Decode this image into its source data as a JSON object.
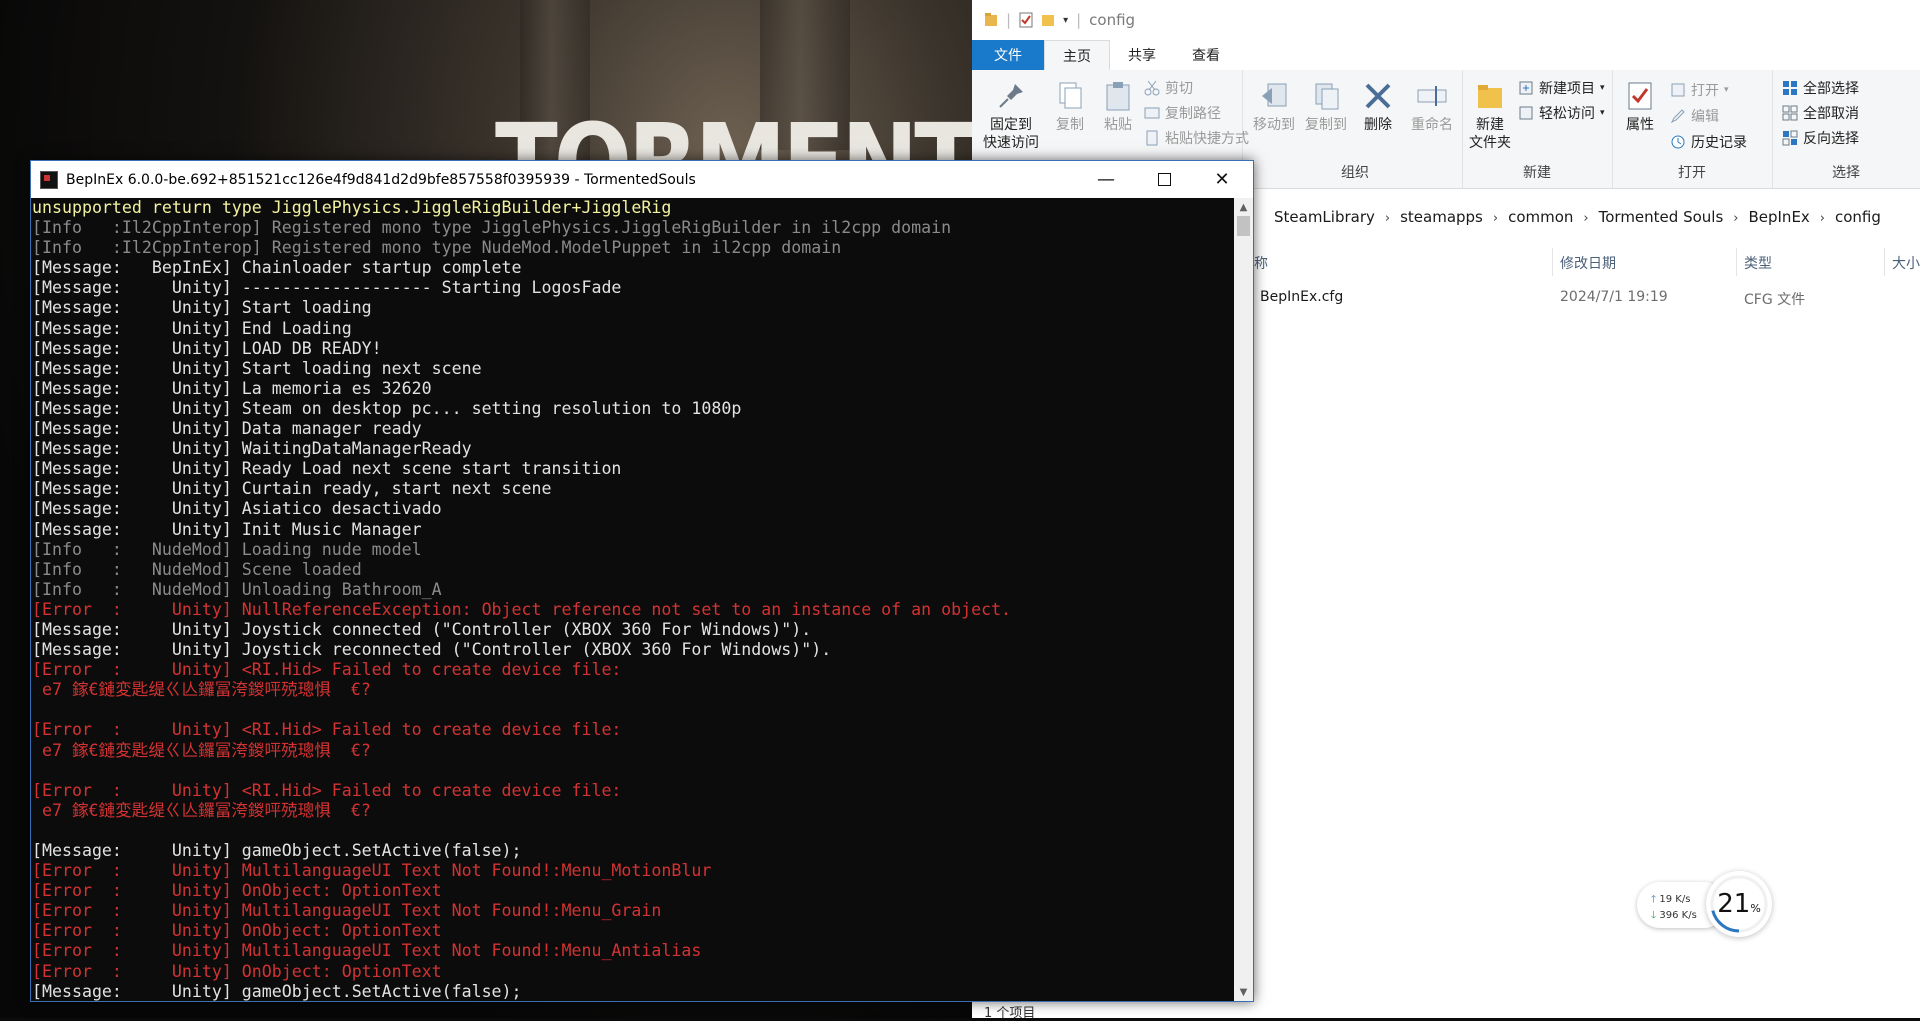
{
  "colors": {
    "accent": "#1979ca",
    "console_bg": "#0c0c0c",
    "error": "#d43232",
    "info": "#8a8a8a",
    "message": "#e2e2e2",
    "warning": "#f2f2a0"
  },
  "game": {
    "logo_text": "TORMENTED"
  },
  "explorer": {
    "title": "config",
    "tabs": {
      "file": "文件",
      "home": "主页",
      "share": "共享",
      "view": "查看"
    },
    "ribbon": {
      "clipboard": {
        "pin": "固定到\n快速访问",
        "copy": "复制",
        "paste": "粘贴",
        "cut": "剪切",
        "copy_path": "复制路径",
        "paste_shortcut": "粘贴快捷方式"
      },
      "organize": {
        "label": "组织",
        "move_to": "移动到",
        "copy_to": "复制到",
        "delete": "删除",
        "rename": "重命名"
      },
      "new": {
        "label": "新建",
        "new_folder": "新建\n文件夹",
        "new_item": "新建项目",
        "easy_access": "轻松访问"
      },
      "open": {
        "label": "打开",
        "properties": "属性",
        "open": "打开",
        "edit": "编辑",
        "history": "历史记录"
      },
      "select": {
        "label": "选择",
        "select_all": "全部选择",
        "select_none": "全部取消",
        "invert": "反向选择"
      }
    },
    "breadcrumbs": [
      "SteamLibrary",
      "steamapps",
      "common",
      "Tormented Souls",
      "BepInEx",
      "config"
    ],
    "columns": {
      "name": "称",
      "modified": "修改日期",
      "type": "类型",
      "size": "大小"
    },
    "files": [
      {
        "name": "BepInEx.cfg",
        "modified": "2024/7/1 19:19",
        "type": "CFG 文件"
      }
    ],
    "status": "1 个项目"
  },
  "console": {
    "title": "BepInEx 6.0.0-be.692+851521cc126e4f9d841d2d9bfe857558f0395939 - TormentedSouls",
    "lines": [
      {
        "c": "y",
        "t": "unsupported return type JigglePhysics.JiggleRigBuilder+JiggleRig"
      },
      {
        "c": "g",
        "t": "[Info   :Il2CppInterop] Registered mono type JigglePhysics.JiggleRigBuilder in il2cpp domain"
      },
      {
        "c": "g",
        "t": "[Info   :Il2CppInterop] Registered mono type NudeMod.ModelPuppet in il2cpp domain"
      },
      {
        "c": "w",
        "t": "[Message:   BepInEx] Chainloader startup complete"
      },
      {
        "c": "w",
        "t": "[Message:     Unity] ------------------- Starting LogosFade"
      },
      {
        "c": "w",
        "t": "[Message:     Unity] Start loading"
      },
      {
        "c": "w",
        "t": "[Message:     Unity] End Loading"
      },
      {
        "c": "w",
        "t": "[Message:     Unity] LOAD DB READY!"
      },
      {
        "c": "w",
        "t": "[Message:     Unity] Start loading next scene"
      },
      {
        "c": "w",
        "t": "[Message:     Unity] La memoria es 32620"
      },
      {
        "c": "w",
        "t": "[Message:     Unity] Steam on desktop pc... setting resolution to 1080p"
      },
      {
        "c": "w",
        "t": "[Message:     Unity] Data manager ready"
      },
      {
        "c": "w",
        "t": "[Message:     Unity] WaitingDataManagerReady"
      },
      {
        "c": "w",
        "t": "[Message:     Unity] Ready Load next scene start transition"
      },
      {
        "c": "w",
        "t": "[Message:     Unity] Curtain ready, start next scene"
      },
      {
        "c": "w",
        "t": "[Message:     Unity] Asiatico desactivado"
      },
      {
        "c": "w",
        "t": "[Message:     Unity] Init Music Manager"
      },
      {
        "c": "g",
        "t": "[Info   :   NudeMod] Loading nude model"
      },
      {
        "c": "g",
        "t": "[Info   :   NudeMod] Scene loaded"
      },
      {
        "c": "g",
        "t": "[Info   :   NudeMod] Unloading Bathroom_A"
      },
      {
        "c": "r",
        "t": "[Error  :     Unity] NullReferenceException: Object reference not set to an instance of an object."
      },
      {
        "c": "w",
        "t": "[Message:     Unity] Joystick connected (\"Controller (XBOX 360 For Windows)\")."
      },
      {
        "c": "w",
        "t": "[Message:     Unity] Joystick reconnected (\"Controller (XBOX 360 For Windows)\")."
      },
      {
        "c": "r",
        "t": "[Error  :     Unity] <RI.Hid> Failed to create device file:"
      },
      {
        "c": "r",
        "t": " e7 鎵€鏈変匙缇ㄍ亾鑼冨洿鍐呯殑璁惧  €?"
      },
      {
        "c": "r",
        "t": ""
      },
      {
        "c": "r",
        "t": "[Error  :     Unity] <RI.Hid> Failed to create device file:"
      },
      {
        "c": "r",
        "t": " e7 鎵€鏈変匙缇ㄍ亾鑼冨洿鍐呯殑璁惧  €?"
      },
      {
        "c": "r",
        "t": ""
      },
      {
        "c": "r",
        "t": "[Error  :     Unity] <RI.Hid> Failed to create device file:"
      },
      {
        "c": "r",
        "t": " e7 鎵€鏈変匙缇ㄍ亾鑼冨洿鍐呯殑璁惧  €?"
      },
      {
        "c": "r",
        "t": ""
      },
      {
        "c": "w",
        "t": "[Message:     Unity] gameObject.SetActive(false);"
      },
      {
        "c": "r",
        "t": "[Error  :     Unity] MultilanguageUI Text Not Found!:Menu_MotionBlur"
      },
      {
        "c": "r",
        "t": "[Error  :     Unity] OnObject: OptionText"
      },
      {
        "c": "r",
        "t": "[Error  :     Unity] MultilanguageUI Text Not Found!:Menu_Grain"
      },
      {
        "c": "r",
        "t": "[Error  :     Unity] OnObject: OptionText"
      },
      {
        "c": "r",
        "t": "[Error  :     Unity] MultilanguageUI Text Not Found!:Menu_Antialias"
      },
      {
        "c": "r",
        "t": "[Error  :     Unity] OnObject: OptionText"
      },
      {
        "c": "w",
        "t": "[Message:     Unity] gameObject.SetActive(false);"
      }
    ]
  },
  "network": {
    "upload": "19  K/s",
    "download": "396 K/s",
    "cpu_percent": "21",
    "percent_sign": "%"
  }
}
